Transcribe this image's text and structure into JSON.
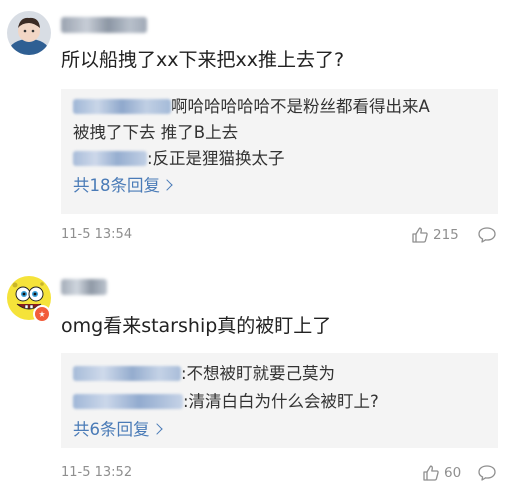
{
  "comments": [
    {
      "avatar": "child-photo-avatar",
      "username": "",
      "text": "所以船拽了xx下来把xx推上去了?",
      "replies": [
        {
          "user": "",
          "text": "啊哈哈哈哈哈不是粉丝都看得出来A"
        },
        {
          "user": "",
          "text": "被拽了下去 推了B上去"
        },
        {
          "user": "",
          "text": ":反正是狸猫换太子"
        }
      ],
      "more_replies": "共18条回复",
      "timestamp": "11-5 13:54",
      "likes": "215"
    },
    {
      "avatar": "spongebob-avatar",
      "username": "",
      "text": "omg看来starship真的被盯上了",
      "replies": [
        {
          "user": "",
          "text": ":不想被盯就要己莫为"
        },
        {
          "user": "",
          "text": ":清清白白为什么会被盯上?"
        }
      ],
      "more_replies": "共6条回复",
      "timestamp": "11-5 13:52",
      "likes": "60"
    }
  ],
  "colors": {
    "link": "#4a7bb7",
    "meta": "#8f8f8f",
    "reply_bg": "#f4f4f4",
    "badge": "#f25c3b"
  }
}
